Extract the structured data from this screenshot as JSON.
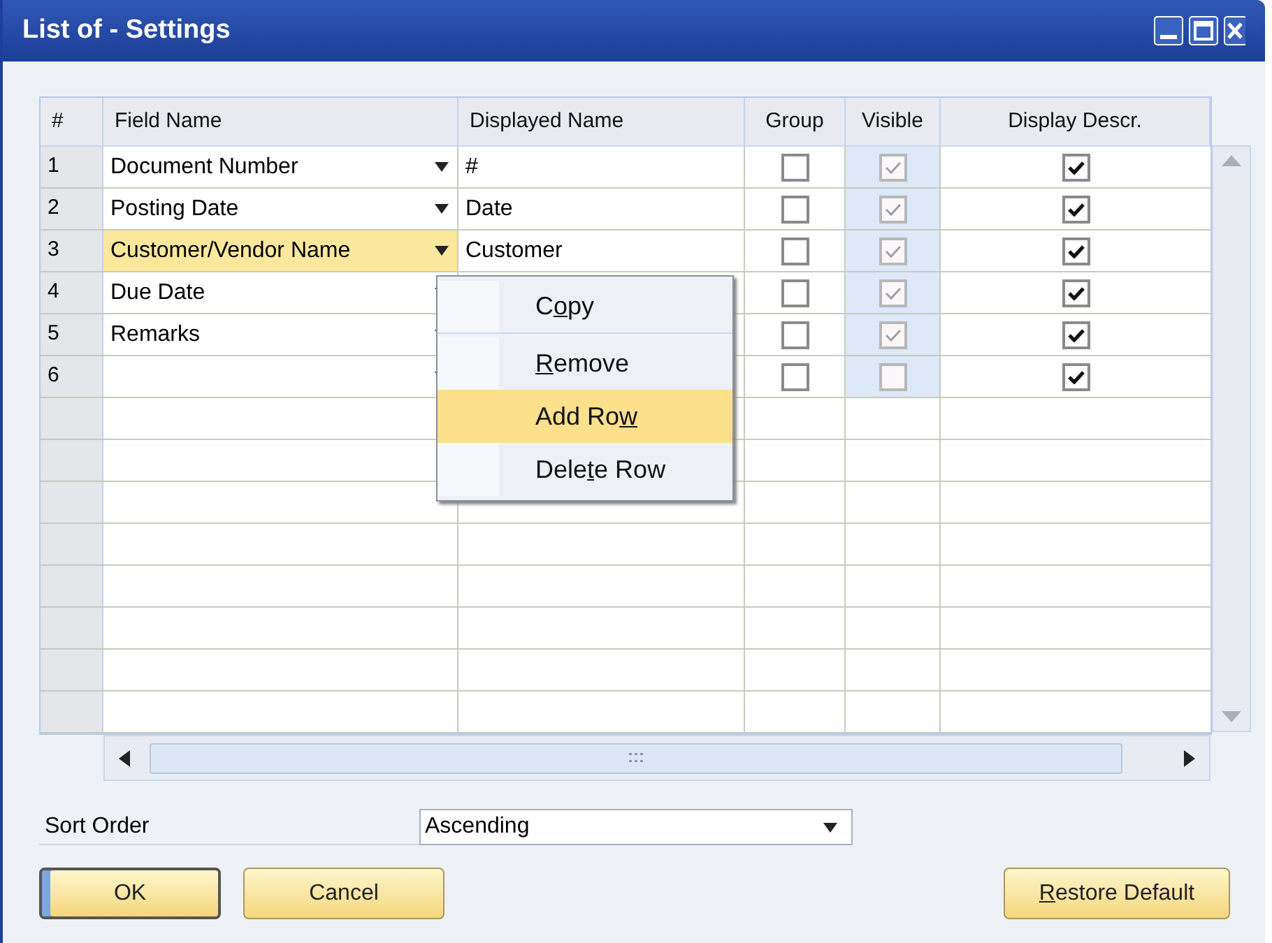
{
  "window": {
    "title": "List of - Settings"
  },
  "table": {
    "columns": [
      "#",
      "Field Name",
      "Displayed Name",
      "Group",
      "Visible",
      "Display Descr."
    ],
    "rows": [
      {
        "number": "1",
        "field_name": "Document Number",
        "displayed_name": "#",
        "group": false,
        "visible": true,
        "display_descr": true,
        "selected": false
      },
      {
        "number": "2",
        "field_name": "Posting Date",
        "displayed_name": "Date",
        "group": false,
        "visible": true,
        "display_descr": true,
        "selected": false
      },
      {
        "number": "3",
        "field_name": "Customer/Vendor Name",
        "displayed_name": "Customer",
        "group": false,
        "visible": true,
        "display_descr": true,
        "selected": true
      },
      {
        "number": "4",
        "field_name": "Due Date",
        "group": false,
        "visible": true,
        "display_descr": true,
        "selected": false
      },
      {
        "number": "5",
        "field_name": "Remarks",
        "group": false,
        "visible": true,
        "display_descr": true,
        "selected": false
      },
      {
        "number": "6",
        "group": false,
        "visible": false,
        "display_descr": true,
        "selected": false
      }
    ]
  },
  "context_menu": {
    "items": [
      {
        "before": "C",
        "key": "o",
        "after": "py",
        "selected": false
      },
      {
        "key": "R",
        "after": "emove",
        "selected": false
      },
      {
        "before": "Add Ro",
        "key": "w",
        "selected": true
      },
      {
        "before": "Dele",
        "key": "t",
        "after": "e Row",
        "selected": false
      }
    ]
  },
  "sort_order": {
    "label": "Sort Order",
    "value": "Ascending"
  },
  "buttons": [
    {
      "after": "OK",
      "kind": "default"
    },
    {
      "after": "Cancel",
      "kind": "normal"
    },
    {
      "key": "R",
      "after": "estore Default",
      "kind": "normal"
    }
  ]
}
